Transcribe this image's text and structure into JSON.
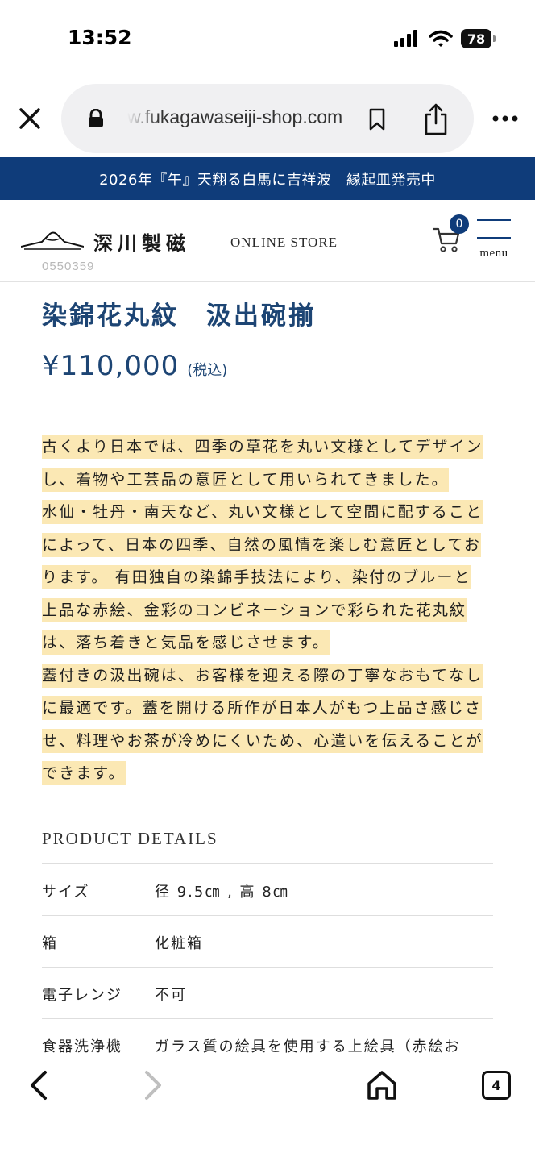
{
  "status_bar": {
    "time": "13:52",
    "battery": "78"
  },
  "browser": {
    "url": "w.fukagawaseiji-shop.com",
    "open_tabs": "4"
  },
  "announcement": "2026年『午』天翔る白馬に吉祥波　縁起皿発売中",
  "header": {
    "logo_kanji": "深川製磁",
    "logo_sub": "ONLINE STORE",
    "cart_count": "0",
    "menu_label": "menu"
  },
  "product": {
    "code": "0550359",
    "title": "染錦花丸紋　汲出碗揃",
    "price": "¥110,000",
    "tax_note": "(税込)",
    "description_lines": [
      "古くより日本では、四季の草花を丸い文様としてデザイン",
      "し、着物や工芸品の意匠として用いられてきました。",
      "水仙・牡丹・南天など、丸い文様として空間に配すること",
      "によって、日本の四季、自然の風情を楽しむ意匠としてお",
      "ります。 有田独自の染錦手技法により、染付のブルーと",
      "上品な赤絵、金彩のコンビネーションで彩られた花丸紋",
      "は、落ち着きと気品を感じさせます。",
      "蓋付きの汲出碗は、お客様を迎える際の丁寧なおもてなし",
      "に最適です。蓋を開ける所作が日本人がもつ上品さ感じさ",
      "せ、料理やお茶が冷めにくいため、心遣いを伝えることが",
      "できます。"
    ]
  },
  "details": {
    "heading": "PRODUCT DETAILS",
    "rows": [
      {
        "label": "サイズ",
        "value": "径 9.5㎝ , 高 8㎝"
      },
      {
        "label": "箱",
        "value": "化粧箱"
      },
      {
        "label": "電子レンジ",
        "value": "不可"
      },
      {
        "label": "食器洗浄機",
        "value": "ガラス質の絵具を使用する上絵具（赤絵お"
      }
    ]
  },
  "colors": {
    "brand_navy": "#0f3c7a",
    "title_blue": "#1d4574",
    "highlight": "#fbe8b4"
  },
  "icons": [
    "close-icon",
    "lock-icon",
    "bookmark-icon",
    "share-icon",
    "more-icon",
    "cart-icon",
    "hamburger-icon",
    "back-icon",
    "forward-icon",
    "home-icon",
    "tabs-icon"
  ]
}
